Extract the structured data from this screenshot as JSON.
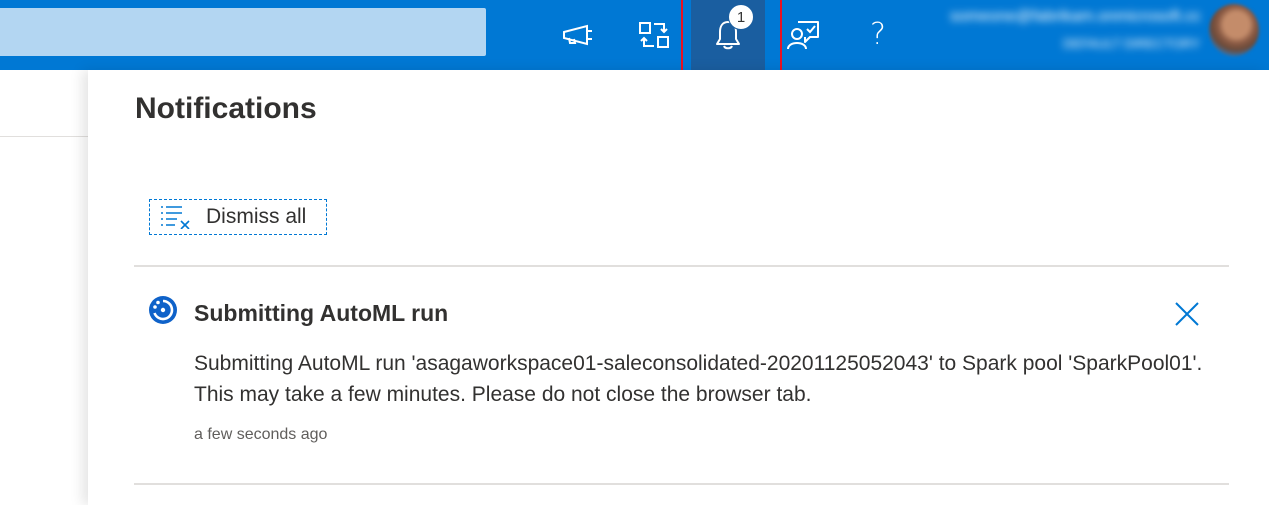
{
  "topbar": {
    "search_placeholder": "",
    "notification_count": "1",
    "help_glyph": "?",
    "user_email": "someone@fabrikam.onmicrosoft.com",
    "user_directory": "DEFAULT DIRECTORY",
    "icons": [
      "announcement-icon",
      "directory-switch-icon",
      "bell-icon",
      "feedback-icon",
      "help-icon"
    ],
    "accent_color": "#0078d4",
    "highlight_color": "#e81123"
  },
  "panel": {
    "title": "Notifications",
    "dismiss_all_label": "Dismiss all"
  },
  "notifications": [
    {
      "title": "Submitting AutoML run",
      "message": "Submitting AutoML run 'asagaworkspace01-saleconsolidated-20201125052043' to Spark pool 'SparkPool01'. This may take a few minutes. Please do not close the browser tab.",
      "time": "a few seconds ago",
      "status_icon": "in-progress-icon"
    }
  ]
}
